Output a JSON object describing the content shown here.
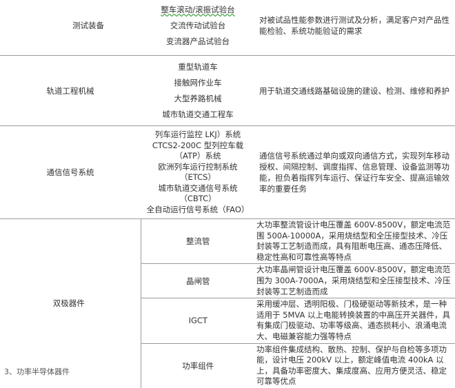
{
  "rows": [
    {
      "category": "测试装备",
      "items": [
        "整车滚动/滚振试验台",
        "交流传动试验台",
        "变流器产品试验台"
      ],
      "description": "对被试品性能参数进行测试及分析，满足客户对产品性能检验、系统功能验证的需求"
    },
    {
      "category": "轨道工程机械",
      "items": [
        "重型轨道车",
        "接触网作业车",
        "大型养路机械",
        "城市轨道交通工程车"
      ],
      "description": "用于轨道交通线路基础设施的建设、检测、维修和养护"
    },
    {
      "category": "通信信号系统",
      "items": [
        "列车运行监控 LKJ）系统",
        "CTCS2-200C 型列控车载",
        "（ATP）系统",
        "欧洲列车运行控制系统",
        "（ETCS）",
        "城市轨道交通信号系统",
        "（CBTC）",
        "全自动运行信号系统（FAO）"
      ],
      "description": "通信信号系统通过单向或双向通信方式，实现列车移动授权、间隔控制、调度指挥、信息管理、设备监测等功能，担负着指挥列车运行、保证行车安全、提高运输效率的重要任务"
    },
    {
      "category": "双极器件",
      "subrows": [
        {
          "name": "整流管",
          "description": "大功率整流管设计电压覆盖 600V-8500V，额定电流范围 500A-10000A，采用烧结型和全压接型技术、冷压封装等工艺制造而成，具有阻断电压高、通态压降低、稳定性高和可靠性高等特点"
        },
        {
          "name": "晶闸管",
          "description": "大功率晶闸管设计电压覆盖 600V-8500V，额定电流范围为 300A-7000A，采用烧结型和全压接型技术、冷压封装等工艺制造而成"
        },
        {
          "name": "IGCT",
          "description": "采用缓冲层、透明阳极、门极硬驱动等新技术，是一种适用于 5MVA 以上电能转换装置的中高压开关器件，具有集成门极驱动、功率等级高、通态损耗小、浪涌电流大、电磁兼容能力强等特点"
        },
        {
          "name": "功率组件",
          "description": "功率组件集成结构、散热、控制、保护与自检等多项功能，设计电压 200kV 以上，额定峰值电流 400kA 以上，具备功率密度大、集成度高、应用方便灵活、稳定可靠等优点"
        }
      ]
    }
  ],
  "footer_fragment": "3、功率半导体器件"
}
